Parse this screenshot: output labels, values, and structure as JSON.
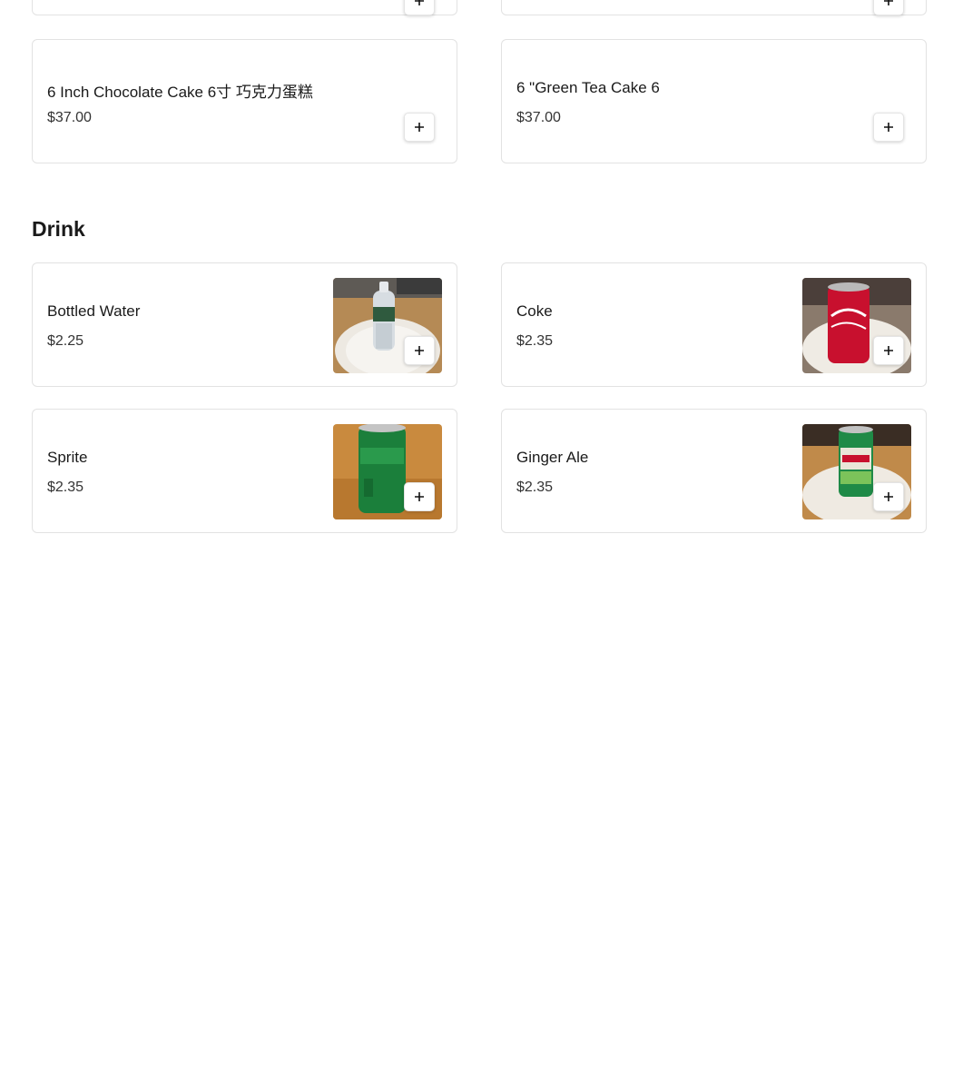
{
  "cakes": {
    "items": [
      {
        "name": "6 Inch Chocolate Cake 6寸 巧克力蛋糕",
        "price": "$37.00"
      },
      {
        "name": "6 \"Green Tea Cake 6",
        "price": "$37.00"
      }
    ]
  },
  "drink": {
    "title": "Drink",
    "items": [
      {
        "name": "Bottled Water",
        "price": "$2.25",
        "image": "bottled-water-photo"
      },
      {
        "name": "Coke",
        "price": "$2.35",
        "image": "coke-can-photo"
      },
      {
        "name": "Sprite",
        "price": "$2.35",
        "image": "sprite-can-photo"
      },
      {
        "name": "Ginger Ale",
        "price": "$2.35",
        "image": "ginger-ale-can-photo"
      }
    ]
  },
  "add_button_icon": "plus-icon",
  "colors": {
    "card_border": "#e2e2e2",
    "coke_red": "#c8102e",
    "sprite_green": "#1b7f3b",
    "ginger_ale_green": "#1f8a47",
    "table_wood": "#c98a3e"
  }
}
